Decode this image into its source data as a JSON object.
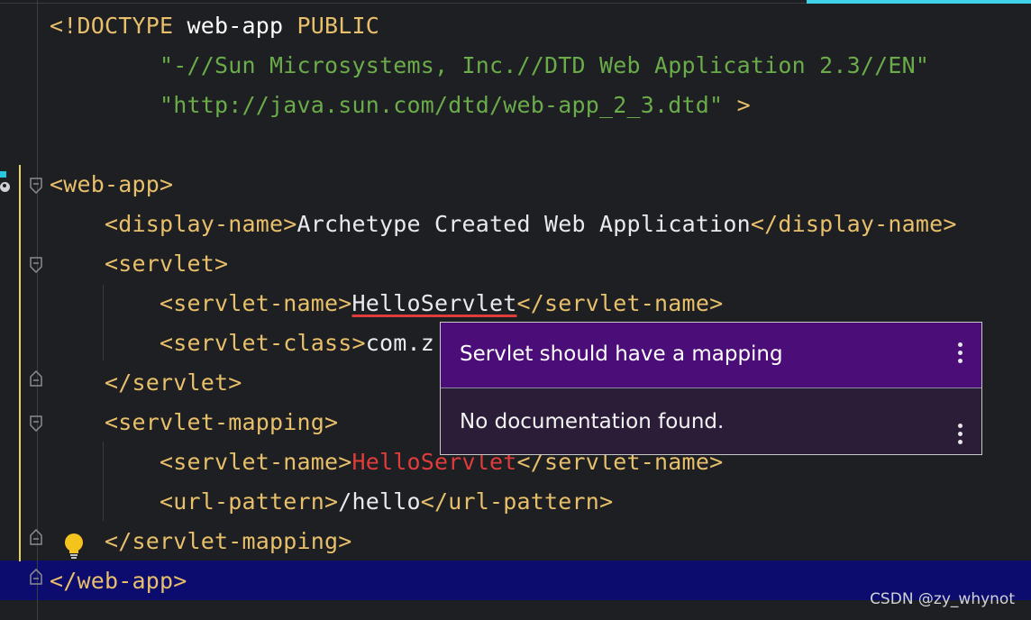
{
  "editor": {
    "lines": [
      {
        "parts": [
          [
            "<!DOCTYPE ",
            "t-doctype"
          ],
          [
            "web-app",
            "t-kw"
          ],
          [
            " PUBLIC",
            "t-doctype"
          ]
        ]
      },
      {
        "parts": [
          [
            "        \"-//Sun Microsystems, Inc.//DTD Web Application 2.3//EN\"",
            "t-str"
          ]
        ]
      },
      {
        "parts": [
          [
            "        \"http://java.sun.com/dtd/web-app_2_3.dtd\"",
            "t-str"
          ],
          [
            " >",
            "t-doctype"
          ]
        ]
      },
      {
        "parts": []
      },
      {
        "parts": [
          [
            "<web-app>",
            "t-tag"
          ]
        ]
      },
      {
        "parts": [
          [
            "    <display-name>",
            "t-tag"
          ],
          [
            "Archetype Created Web Application",
            "t-text"
          ],
          [
            "</display-name>",
            "t-tag"
          ]
        ]
      },
      {
        "parts": [
          [
            "    <servlet>",
            "t-tag"
          ]
        ]
      },
      {
        "parts": [
          [
            "        <servlet-name>",
            "t-tag"
          ],
          [
            "HelloServlet",
            "t-text underline-red"
          ],
          [
            "</servlet-name>",
            "t-tag"
          ]
        ]
      },
      {
        "parts": [
          [
            "        <servlet-class>",
            "t-tag"
          ],
          [
            "com.z",
            "t-text"
          ]
        ]
      },
      {
        "parts": [
          [
            "    </servlet>",
            "t-tag"
          ]
        ]
      },
      {
        "parts": [
          [
            "    <servlet-mapping>",
            "t-tag"
          ]
        ]
      },
      {
        "parts": [
          [
            "        <servlet-name>",
            "t-tag"
          ],
          [
            "HelloServlet",
            "t-err"
          ],
          [
            "</servlet-name>",
            "t-tag"
          ]
        ]
      },
      {
        "parts": [
          [
            "        <url-pattern>",
            "t-tag"
          ],
          [
            "/hello",
            "t-text"
          ],
          [
            "</url-pattern>",
            "t-tag"
          ]
        ]
      },
      {
        "parts": [
          [
            "    </servlet-mapping>",
            "t-tag"
          ]
        ]
      },
      {
        "parts": [
          [
            "</web-app>",
            "t-tag"
          ]
        ]
      }
    ]
  },
  "popup": {
    "title": "Servlet should have a mapping",
    "body": "No documentation found."
  },
  "watermark": "CSDN @zy_whynot",
  "colors": {
    "tag": "#e8bf6a",
    "string": "#6aab4a",
    "error": "#e03c3c",
    "popup_header": "#4b0d78",
    "popup_body": "#2b1d38",
    "current_line": "#0c0c6e"
  }
}
